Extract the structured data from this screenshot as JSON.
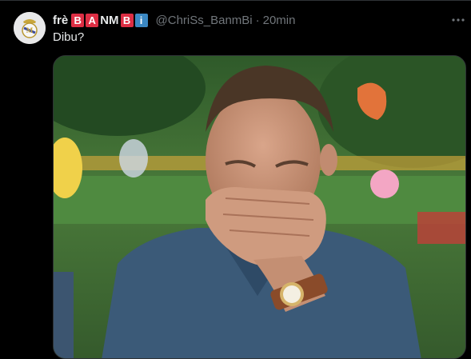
{
  "tweet": {
    "display_name": "frè",
    "badge_letters": [
      {
        "text": "B",
        "kind": "tile"
      },
      {
        "text": "A",
        "kind": "tile"
      },
      {
        "text": "NM",
        "kind": "plain"
      },
      {
        "text": "B",
        "kind": "tile"
      },
      {
        "text": "i",
        "kind": "tile-blue"
      }
    ],
    "handle": "@ChriSs_BanmBi",
    "separator": "·",
    "time": "20min",
    "text": "Dibu?"
  },
  "colors": {
    "background": "#000000",
    "text_primary": "#e7e9ea",
    "text_secondary": "#71767b",
    "tile_red": "#dd2e44",
    "tile_blue": "#3b88c3"
  },
  "icons": {
    "avatar": "real-madrid-crest-avatar",
    "more": "more-dots-icon"
  }
}
